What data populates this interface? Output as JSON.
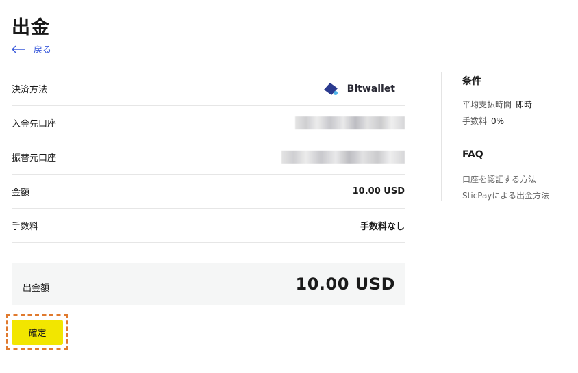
{
  "page": {
    "title": "出金",
    "back_label": "戻る"
  },
  "rows": [
    {
      "label": "決済方法",
      "value": "Bitwallet"
    },
    {
      "label": "入金先口座",
      "value": ""
    },
    {
      "label": "振替元口座",
      "value": ""
    },
    {
      "label": "金額",
      "value": "10.00 USD"
    },
    {
      "label": "手数料",
      "value": "手数料なし"
    }
  ],
  "total": {
    "label": "出金額",
    "amount": "10.00",
    "currency": "USD"
  },
  "confirm_label": "確定",
  "sidebar": {
    "conditions_title": "条件",
    "avg_time_label": "平均支払時間",
    "avg_time_value": "即時",
    "fee_label": "手数料",
    "fee_value": "0%",
    "faq_title": "FAQ",
    "faq_links": [
      "口座を認証する方法",
      "SticPayによる出金方法"
    ]
  },
  "colors": {
    "accent_yellow": "#f2e600",
    "link_blue": "#3b5bdb",
    "highlight_orange": "#e07a2e"
  }
}
